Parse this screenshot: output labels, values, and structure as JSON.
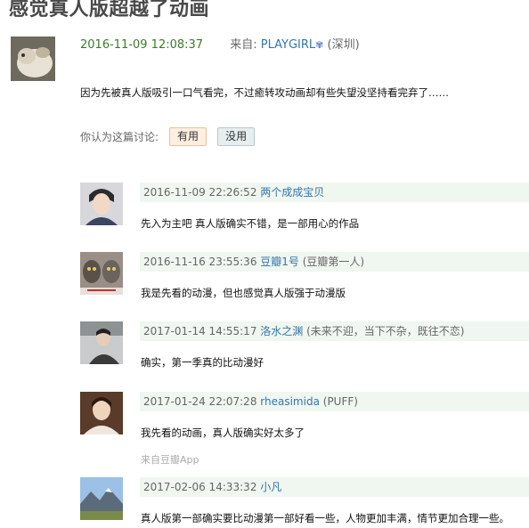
{
  "topic": {
    "title": "感觉真人版超越了动画"
  },
  "post": {
    "time": "2016-11-09 12:08:37",
    "from_label": "来自:",
    "author": "PLAYGIRL",
    "location": "(深圳)",
    "body": "因为先被真人版吸引一口气看完，不过癒转攻动画却有些失望没坚持看完弃了……",
    "vote_prompt": "你认为这篇讨论:",
    "useful_label": "有用",
    "useless_label": "没用"
  },
  "replies": [
    {
      "time": "2016-11-09 22:26:52",
      "author": "两个成成宝贝",
      "extra": "",
      "body": "先入为主吧 真人版确实不错，是一部用心的作品",
      "sub": ""
    },
    {
      "time": "2016-11-16 23:55:36",
      "author": "豆瓣1号",
      "extra": "(豆瓣第一人)",
      "body": "我是先看的动漫，但也感觉真人版强于动漫版",
      "sub": ""
    },
    {
      "time": "2017-01-14 14:55:17",
      "author": "洛水之渊",
      "extra": "(未来不迎，当下不杂，既往不恋)",
      "body": "确实，第一季真的比动漫好",
      "sub": ""
    },
    {
      "time": "2017-01-24 22:07:28",
      "author": "rheasimida",
      "extra": "(PUFF)",
      "body": "我先看的动画，真人版确实好太多了",
      "sub": "来自豆瓣App"
    },
    {
      "time": "2017-02-06 14:33:32",
      "author": "小凡",
      "extra": "",
      "body": "真人版第一部确实要比动漫第一部好看一些，人物更加丰满，情节更加合理一些。",
      "sub": ""
    }
  ]
}
